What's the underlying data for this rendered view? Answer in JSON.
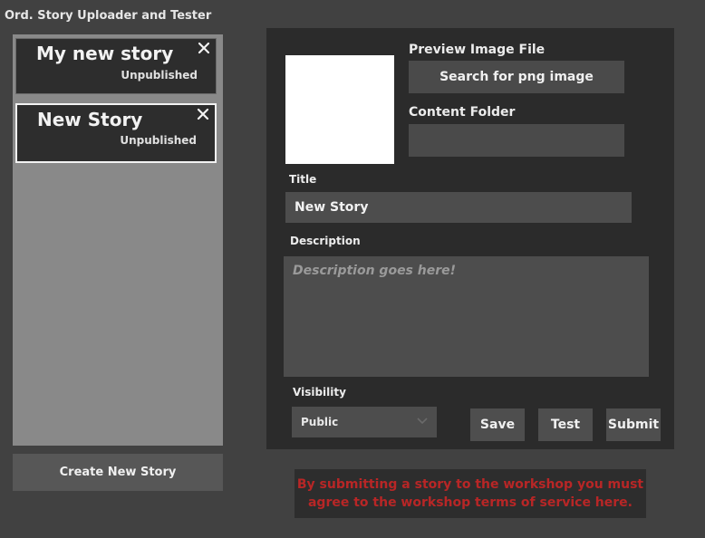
{
  "app": {
    "title": "Ord. Story Uploader and Tester"
  },
  "story_list": {
    "items": [
      {
        "title": "My new story",
        "status": "Unpublished",
        "selected": false
      },
      {
        "title": "New Story",
        "status": "Unpublished",
        "selected": true
      }
    ],
    "create_label": "Create New Story"
  },
  "editor": {
    "preview_label": "Preview Image File",
    "search_button_label": "Search for png image",
    "content_folder_label": "Content Folder",
    "content_folder_value": "",
    "title_label": "Title",
    "title_value": "New Story",
    "description_label": "Description",
    "description_placeholder": "Description goes here!",
    "visibility_label": "Visibility",
    "visibility_value": "Public",
    "save_label": "Save",
    "test_label": "Test",
    "submit_label": "Submit"
  },
  "tos": {
    "text_line1": "By submitting a story to the workshop you must",
    "text_line2": "agree to the workshop terms of service here."
  },
  "colors": {
    "background": "#414141",
    "panel": "#2b2b2b",
    "list_background": "#898989",
    "tos_text": "#b82626"
  },
  "icons": {
    "close": "close-icon",
    "dropdown": "chevron-down-icon"
  }
}
